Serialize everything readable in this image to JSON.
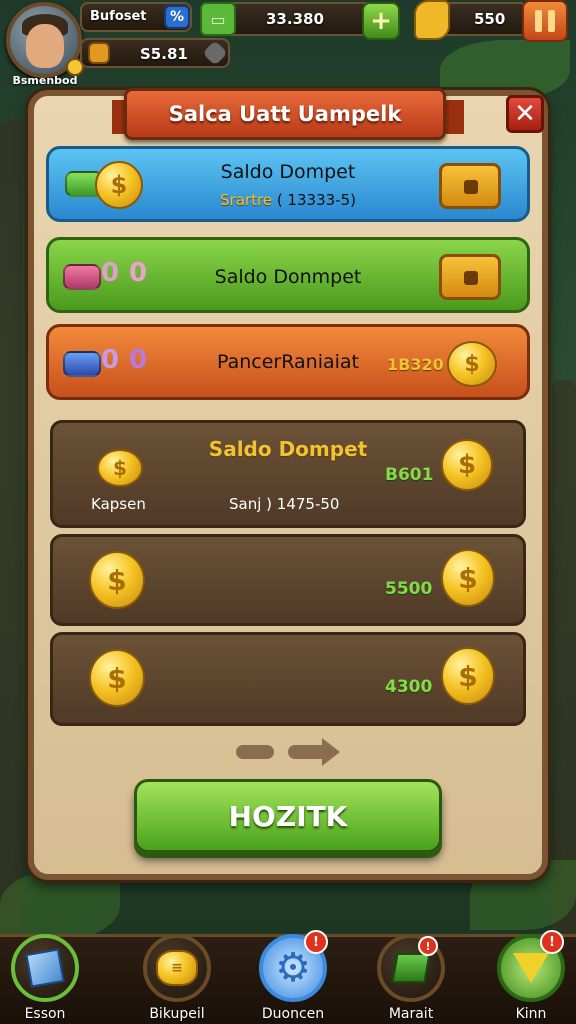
{
  "player": {
    "name": "Bsmenbod"
  },
  "top_bar": {
    "label1": "Bufoset",
    "icon_badge": "%",
    "currency1": "33.380",
    "currency2": "S5.81",
    "currency3": "550"
  },
  "dialog": {
    "title": "Salca Uatt Uampelk",
    "close_symbol": "✕",
    "cards": [
      {
        "title": "Saldo Dompet",
        "subtitle_a": "Srartre",
        "subtitle_b": "( 13333-5)"
      },
      {
        "title": "Saldo Donmpet"
      },
      {
        "title": "PancerRaniaiat",
        "value": "1B320"
      }
    ],
    "balance": {
      "title": "Saldo Dompet",
      "label": "Kapsen",
      "detail": "Sanj ) 1475-50",
      "rows": [
        "B601",
        "5500",
        "4300"
      ]
    },
    "action_button": "HOZITK"
  },
  "nav": [
    {
      "label": "Esson",
      "icon": "cube-icon"
    },
    {
      "label": "Bikupeil",
      "icon": "coin-stack-icon"
    },
    {
      "label": "Duoncen",
      "icon": "gear-icon",
      "badge": "!"
    },
    {
      "label": "Marait",
      "icon": "map-icon",
      "badge": "!"
    },
    {
      "label": "Kinn",
      "icon": "gem-icon",
      "badge": "!"
    }
  ],
  "colors": {
    "panel": "#e9d6b0",
    "ribbon": "#d04a22",
    "blue_card": "#3a9ee0",
    "green_card": "#6bbd32",
    "orange_card": "#e06a2a",
    "gold": "#f1c232",
    "green_value": "#86d94a"
  }
}
